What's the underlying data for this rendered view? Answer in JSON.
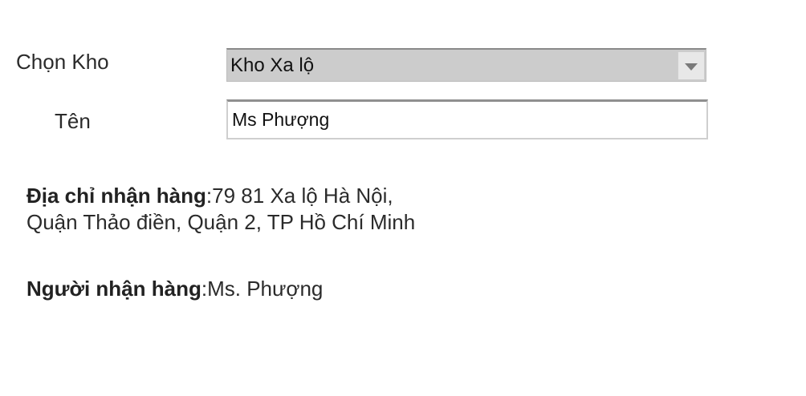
{
  "form": {
    "warehouse_label": "Chọn Kho",
    "warehouse_selected": "Kho Xa lộ",
    "name_label": "Tên",
    "name_value": "Ms Phượng"
  },
  "info": {
    "address_label": "Địa chỉ nhận hàng",
    "address_separator": ":",
    "address_value": "79 81 Xa lộ Hà Nội, Quận Thảo điền, Quận 2, TP Hồ Chí Minh",
    "receiver_label": "Người nhận hàng",
    "receiver_separator": ":",
    "receiver_value": "Ms. Phượng"
  },
  "icons": {
    "dropdown": "chevron-down-icon"
  },
  "colors": {
    "select_background": "#cccccc",
    "text": "#2b2b2b"
  }
}
